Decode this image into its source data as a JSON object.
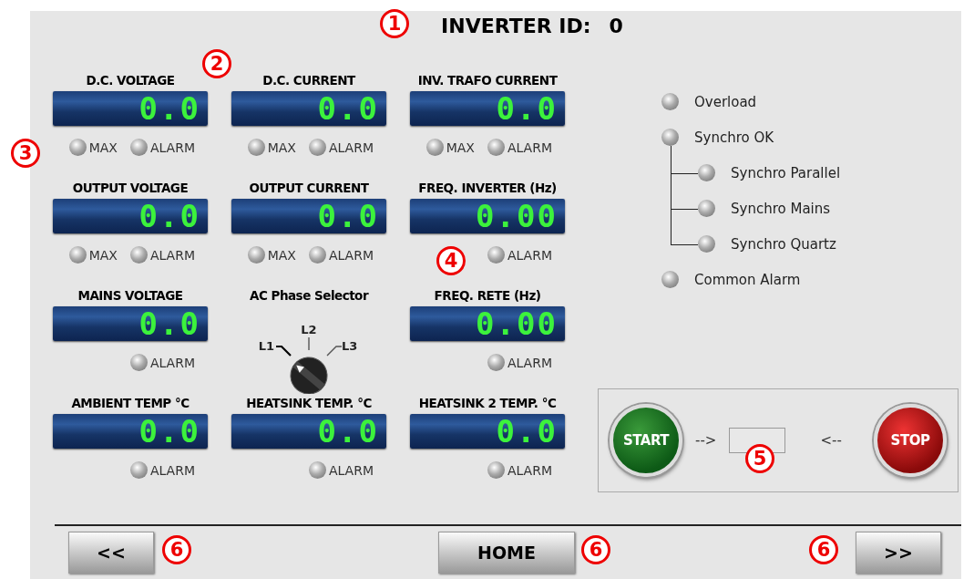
{
  "title": {
    "label": "INVERTER ID:",
    "value": "0"
  },
  "cells": [
    {
      "kind": "meter",
      "label": "D.C. VOLTAGE",
      "value": "0.0",
      "lamps": [
        {
          "label": "MAX",
          "lit": false
        },
        {
          "label": "ALARM",
          "lit": false
        }
      ]
    },
    {
      "kind": "meter",
      "label": "D.C. CURRENT",
      "value": "0.0",
      "lamps": [
        {
          "label": "MAX",
          "lit": false
        },
        {
          "label": "ALARM",
          "lit": false
        }
      ]
    },
    {
      "kind": "meter",
      "label": "INV. TRAFO CURRENT",
      "value": "0.0",
      "lamps": [
        {
          "label": "MAX",
          "lit": false
        },
        {
          "label": "ALARM",
          "lit": false
        }
      ]
    },
    {
      "kind": "meter",
      "label": "OUTPUT VOLTAGE",
      "value": "0.0",
      "lamps": [
        {
          "label": "MAX",
          "lit": false
        },
        {
          "label": "ALARM",
          "lit": false
        }
      ]
    },
    {
      "kind": "meter",
      "label": "OUTPUT CURRENT",
      "value": "0.0",
      "lamps": [
        {
          "label": "MAX",
          "lit": false
        },
        {
          "label": "ALARM",
          "lit": false
        }
      ]
    },
    {
      "kind": "meter",
      "label": "FREQ. INVERTER (Hz)",
      "value": "0.00",
      "lamps": [
        {
          "label": "ALARM",
          "lit": false
        }
      ]
    },
    {
      "kind": "meter",
      "label": "MAINS VOLTAGE",
      "value": "0.0",
      "lamps": [
        {
          "label": "ALARM",
          "lit": false
        }
      ]
    },
    {
      "kind": "selector",
      "label": "AC Phase Selector",
      "positions": [
        {
          "label": "L1",
          "selected": true
        },
        {
          "label": "L2",
          "selected": false
        },
        {
          "label": "L3",
          "selected": false
        }
      ]
    },
    {
      "kind": "meter",
      "label": "FREQ. RETE (Hz)",
      "value": "0.00",
      "lamps": [
        {
          "label": "ALARM",
          "lit": false
        }
      ]
    },
    {
      "kind": "meter",
      "label": "AMBIENT TEMP °C",
      "value": "0.0",
      "lamps": [
        {
          "label": "ALARM",
          "lit": false
        }
      ]
    },
    {
      "kind": "meter",
      "label": "HEATSINK TEMP. °C",
      "value": "0.0",
      "lamps": [
        {
          "label": "ALARM",
          "lit": false
        }
      ]
    },
    {
      "kind": "meter",
      "label": "HEATSINK 2 TEMP. °C",
      "value": "0.0",
      "lamps": [
        {
          "label": "ALARM",
          "lit": false
        }
      ]
    }
  ],
  "status": [
    {
      "label": "Overload",
      "lit": false
    },
    {
      "label": "Synchro OK",
      "lit": false,
      "children": [
        {
          "label": "Synchro Parallel",
          "lit": false
        },
        {
          "label": "Synchro Mains",
          "lit": false
        },
        {
          "label": "Synchro Quartz",
          "lit": false
        }
      ]
    },
    {
      "label": "Common Alarm",
      "lit": false
    }
  ],
  "control": {
    "start": "START",
    "start_arrow": "-->",
    "stop_arrow": "<--",
    "stop": "STOP"
  },
  "nav": [
    "<<",
    "HOME",
    ">>"
  ],
  "callouts": [
    {
      "number": "1"
    },
    {
      "number": "2"
    },
    {
      "number": "3"
    },
    {
      "number": "4"
    },
    {
      "number": "5"
    },
    {
      "number": "6"
    },
    {
      "number": "6"
    },
    {
      "number": "6"
    }
  ]
}
